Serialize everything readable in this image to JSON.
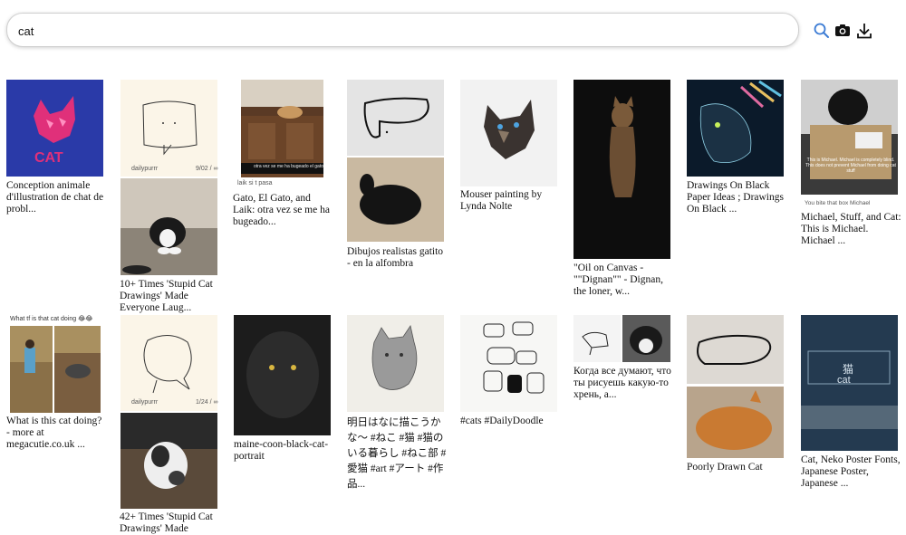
{
  "search": {
    "value": "cat",
    "placeholder": ""
  },
  "toolbar": {
    "search_icon": "search-icon",
    "camera_icon": "camera-icon",
    "download_icon": "download-icon"
  },
  "results": [
    {
      "caption": "Conception animale d'illustration de chat de probl...",
      "overlay": "CAT"
    },
    {
      "caption": "10+ Times 'Stupid Cat Drawings' Made Everyone Laug...",
      "overlay": "dailypurrr",
      "overlay2": "9/02 / ∞"
    },
    {
      "caption": "Gato, El Gato, and Laik: otra vez se me ha bugeado...",
      "overlay": "otra vez se me ha bugeado el gato",
      "overlay2": "laik si t pasa"
    },
    {
      "caption": "Dibujos realistas gatito - en la alfombra"
    },
    {
      "caption": "Mouser painting by Lynda Nolte"
    },
    {
      "caption": "\"Oil on Canvas - \"\"Dignan\"\" - Dignan, the loner, w..."
    },
    {
      "caption": "Drawings On Black Paper Ideas ; Drawings On Black ..."
    },
    {
      "caption": "Michael, Stuff, and Cat: This is Michael. Michael ...",
      "overlay": "This is Michael. Michael is completely blind. This does not prevent Michael from doing cat stuff",
      "overlay2": "You bite that box Michael"
    },
    {
      "caption": "What is this cat doing? - more at megacutie.co.uk ...",
      "overlay": "What tf is that cat doing 😂😂"
    },
    {
      "caption": "42+ Times 'Stupid Cat Drawings' Made",
      "overlay": "dailypurrr",
      "overlay2": "1/24 / ∞"
    },
    {
      "caption": "maine-coon-black-cat-portrait"
    },
    {
      "caption": "明日はなに描こうかな〜 #ねこ #猫 #猫のいる暮らし #ねこ部 #愛猫 #art #アート #作品..."
    },
    {
      "caption": "#cats #DailyDoodle"
    },
    {
      "caption": "Когда все думают, что ты рисуешь какую-то хрень, а..."
    },
    {
      "caption": "Poorly Drawn Cat"
    },
    {
      "caption": "Cat, Neko Poster Fonts, Japanese Poster, Japanese ...",
      "overlay": "猫",
      "overlay2": "cat"
    }
  ]
}
